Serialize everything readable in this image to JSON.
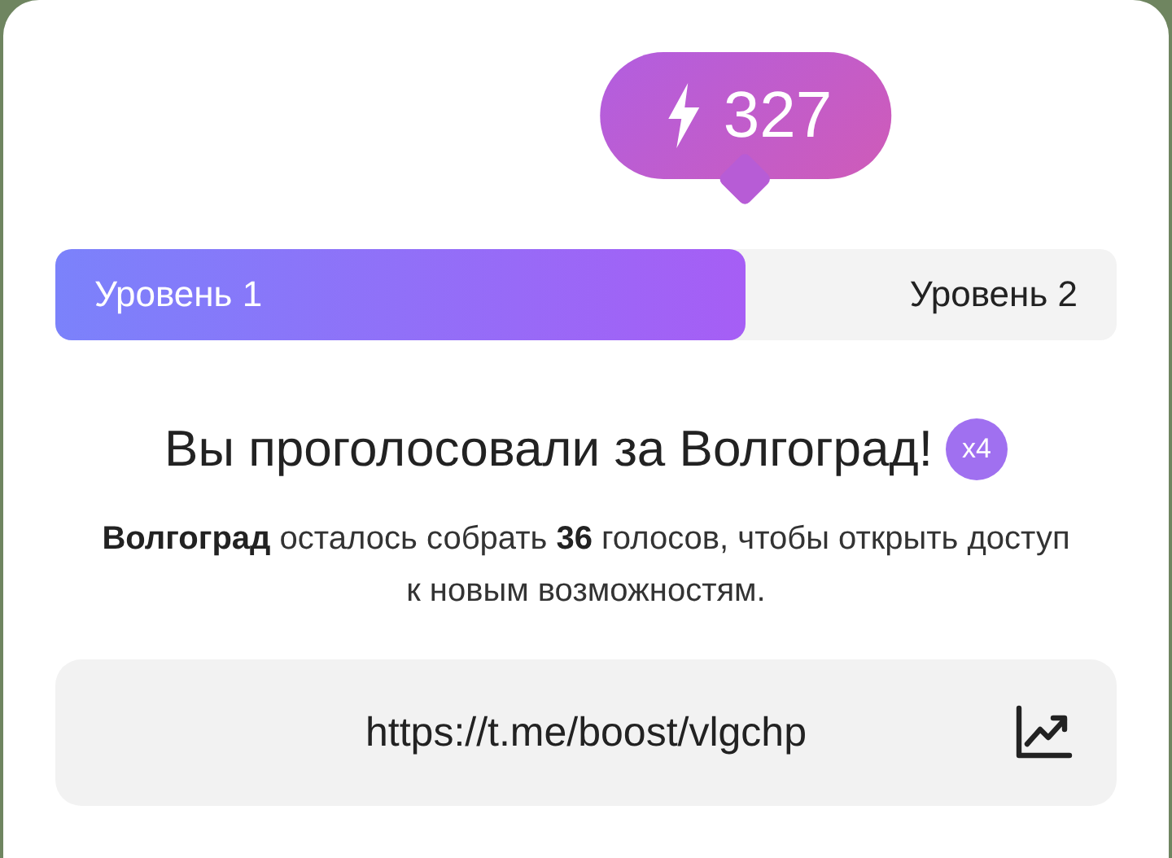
{
  "boost_badge": {
    "count": "327"
  },
  "progress": {
    "level": 0.65,
    "current_label": "Уровень 1",
    "next_label": "Уровень 2"
  },
  "title": {
    "text": "Вы проголосовали за Волгоград!",
    "multiplier": "x4"
  },
  "description": "**Волгоград** осталось собрать **36** голосов, чтобы открыть доступ к новым возможностям.",
  "link": {
    "url": "https://t.me/boost/vlgchp"
  }
}
